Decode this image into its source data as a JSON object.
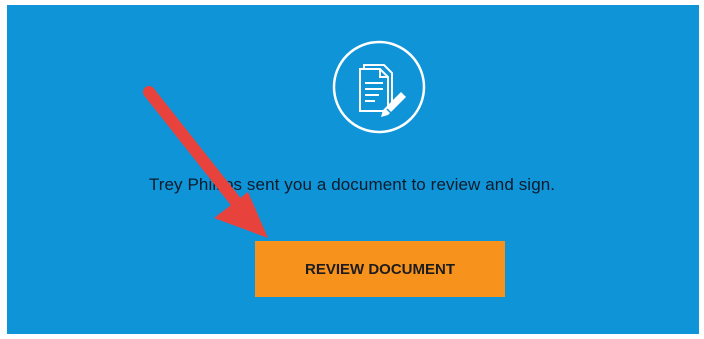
{
  "message": "Trey Phillips sent you a document to review and sign.",
  "review_button_label": "REVIEW DOCUMENT",
  "icon": "document-sign-icon",
  "colors": {
    "banner": "#0f94d8",
    "button": "#f7931d",
    "annotation_arrow": "#e8423d"
  }
}
